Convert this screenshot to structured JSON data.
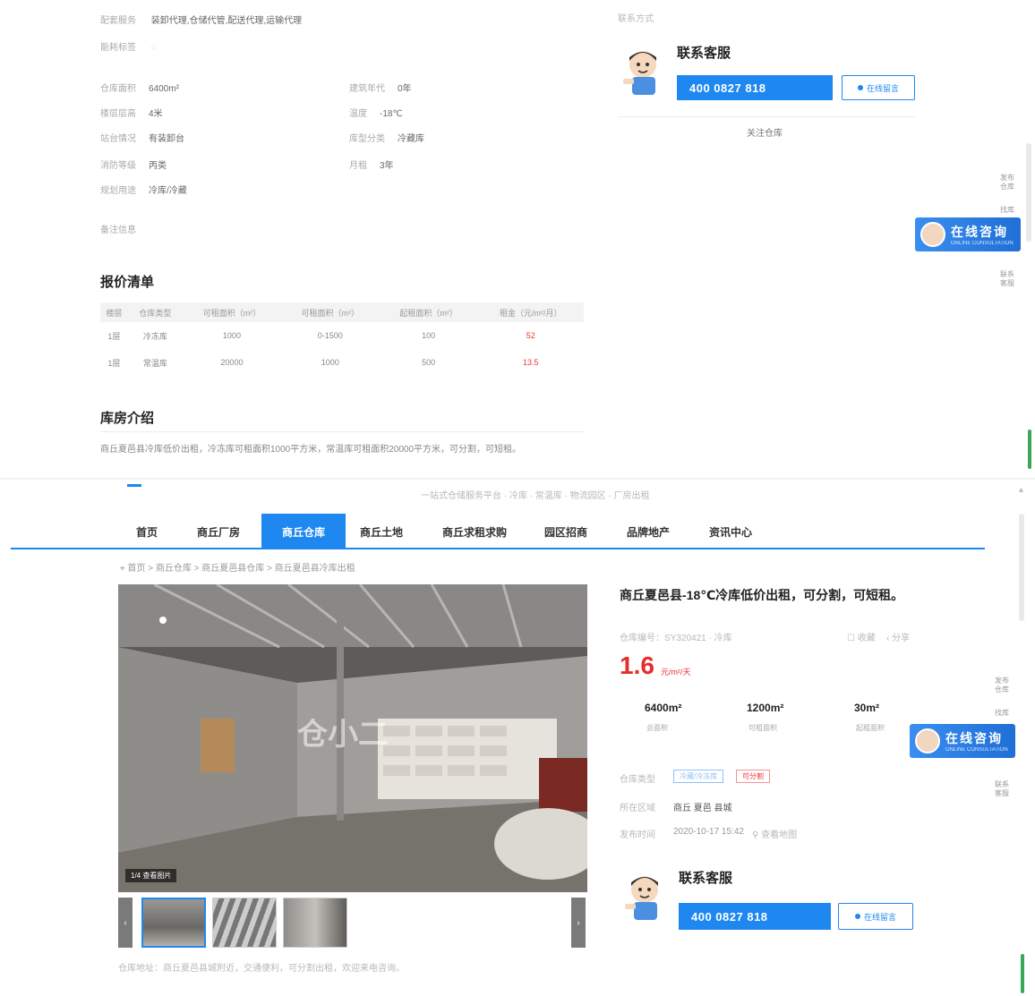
{
  "top_info": {
    "service_label": "配套服务",
    "service_value": "装卸代理,仓储代管,配送代理,运输代理",
    "energy_label": "能耗标签",
    "rows": [
      {
        "l1": "仓库面积",
        "v1": "6400m²",
        "l2": "建筑年代",
        "v2": "0年"
      },
      {
        "l1": "楼层层高",
        "v1": "4米",
        "l2": "温度",
        "v2": "-18℃"
      },
      {
        "l1": "站台情况",
        "v1": "有装卸台",
        "l2": "库型分类",
        "v2": "冷藏库"
      },
      {
        "l1": "消防等级",
        "v1": "丙类",
        "l2": "月租",
        "v2": "3年"
      },
      {
        "l1": "规划用途",
        "v1": "冷库/冷藏",
        "l2": "",
        "v2": ""
      }
    ],
    "remark_label": "备注信息"
  },
  "quote": {
    "title": "报价清单",
    "headers": [
      "楼层",
      "仓库类型",
      "可租面积（m²）",
      "可租面积（m²）",
      "起租面积（m²）",
      "租金（元/m²/月）"
    ],
    "rows": [
      [
        "1层",
        "冷冻库",
        "1000",
        "0-1500",
        "100",
        "52"
      ],
      [
        "1层",
        "常温库",
        "20000",
        "1000",
        "500",
        "13.5"
      ]
    ]
  },
  "intro": {
    "title": "库房介绍",
    "text": "商丘夏邑县冷库低价出租，冷冻库可租面积1000平方米，常温库可租面积20000平方米，可分割，可短租。"
  },
  "contact_top": {
    "caption": "联系方式",
    "title": "联系客服",
    "phone": "400 0827 818",
    "msg": "在线留言",
    "follow": "关注仓库"
  },
  "float": {
    "label": "在线咨询",
    "sub": "ONLINE CONSULTATION"
  },
  "side": {
    "items_top": [
      "发布仓库",
      "找库",
      "联系客服"
    ],
    "items_bottom": [
      "发布仓库",
      "找库",
      "联系客服"
    ]
  },
  "topbar_text": "一站式仓储服务平台 · 冷库 · 常温库 · 物流园区 · 厂房出租",
  "nav": {
    "items": [
      "首页",
      "商丘厂房",
      "商丘仓库",
      "商丘土地",
      "商丘求租求购",
      "园区招商",
      "品牌地产",
      "资讯中心"
    ],
    "active_index": 2
  },
  "breadcrumb": "首页 > 商丘仓库 > 商丘夏邑县仓库 > 商丘夏邑县冷库出租",
  "product": {
    "title": "商丘夏邑县-18℃冷库低价出租，可分割，可短租。",
    "meta": "仓库编号：SY320421 · 冷库",
    "fav": "收藏",
    "share": "分享",
    "price": "1.6",
    "price_unit": "元/m²/天",
    "stats": [
      {
        "value": "6400m²",
        "label": "总面积"
      },
      {
        "value": "1200m²",
        "label": "可租面积"
      },
      {
        "value": "30m²",
        "label": "起租面积"
      }
    ],
    "detail_rows": [
      {
        "label": "仓库类型",
        "tag": "冷藏/冷冻库",
        "tag2": "可分割"
      },
      {
        "label": "所在区域",
        "text": "商丘 夏邑 县城"
      },
      {
        "label": "发布时间",
        "text": "2020-10-17 15:42",
        "loc": "查看地图"
      }
    ],
    "image_badge": "1/4 查看图片",
    "watermark": "仓小二",
    "footer_note": "仓库地址：商丘夏邑县城附近，交通便利，可分割出租，欢迎来电咨询。"
  },
  "contact_bottom": {
    "title": "联系客服",
    "phone": "400 0827 818",
    "msg": "在线留言"
  },
  "colors": {
    "accent": "#1e88f0",
    "price": "#e62d2d"
  }
}
